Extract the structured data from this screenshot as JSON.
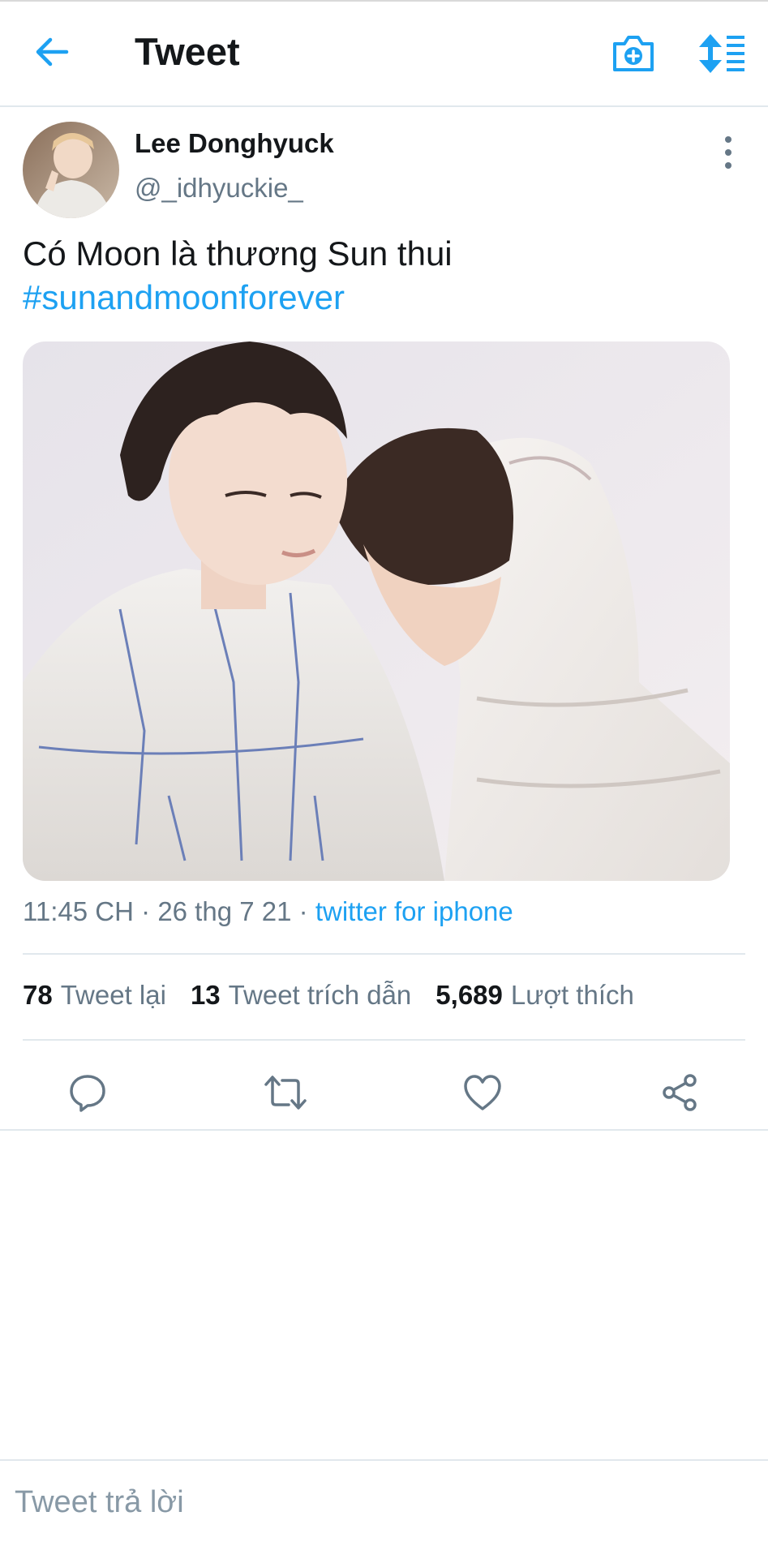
{
  "header": {
    "title": "Tweet",
    "back_icon": "arrow-left-icon",
    "camera_icon": "camera-plus-icon",
    "sort_icon": "sort-list-icon"
  },
  "tweet": {
    "author_name": "Lee Donghyuck",
    "author_handle": "@_idhyuckie_",
    "text": "Có Moon là thương Sun thui",
    "hashtag": "#sunandmoonforever",
    "time": "11:45 CH",
    "date": "26 thg 7 21",
    "source": "twitter for iphone",
    "sep": "·"
  },
  "stats": {
    "retweets_count": "78",
    "retweets_label": "Tweet lại",
    "quotes_count": "13",
    "quotes_label": "Tweet trích dẫn",
    "likes_count": "5,689",
    "likes_label": "Lượt thích"
  },
  "actions": [
    "reply-icon",
    "retweet-icon",
    "like-icon",
    "share-icon"
  ],
  "reply": {
    "placeholder": "Tweet trả lời"
  },
  "colors": {
    "accent": "#1da1f2",
    "text": "#14171a",
    "muted": "#657786",
    "divider": "#e1e8ed"
  }
}
